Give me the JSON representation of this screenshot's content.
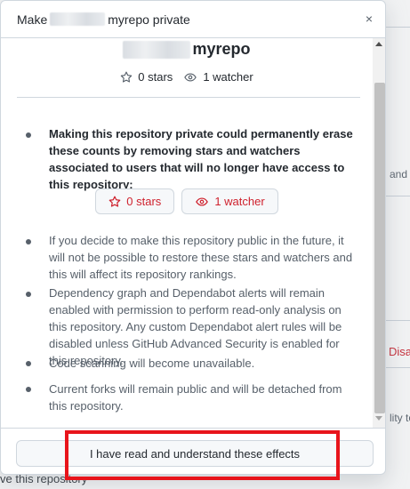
{
  "background": {
    "right_text_1": "and s",
    "right_text_2": "Disa",
    "right_text_3": "lity to",
    "bottom_text": "ve this repository"
  },
  "modal": {
    "title_prefix": "Make",
    "title_suffix": "myrepo private",
    "close_label": "×",
    "repo_name_suffix": "myrepo",
    "stars_label": "0 stars",
    "watchers_label": "1 watcher",
    "warning_bold": "Making this repository private could permanently erase these counts by removing stars and watchers associated to users that will no longer have access to this repository:",
    "pill_stars": "0 stars",
    "pill_watchers": "1 watcher",
    "bullets": [
      "If you decide to make this repository public in the future, it will not be possible to restore these stars and watchers and this will affect its repository rankings.",
      "Dependency graph and Dependabot alerts will remain enabled with permission to perform read-only analysis on this repository. Any custom Dependabot alert rules will be disabled unless GitHub Advanced Security is enabled for this repository.",
      "Code scanning will become unavailable.",
      "Current forks will remain public and will be detached from this repository."
    ],
    "confirm_label": "I have read and understand these effects"
  },
  "colors": {
    "danger": "#cf222e",
    "highlight": "#e8141b",
    "border": "#d0d7de"
  }
}
